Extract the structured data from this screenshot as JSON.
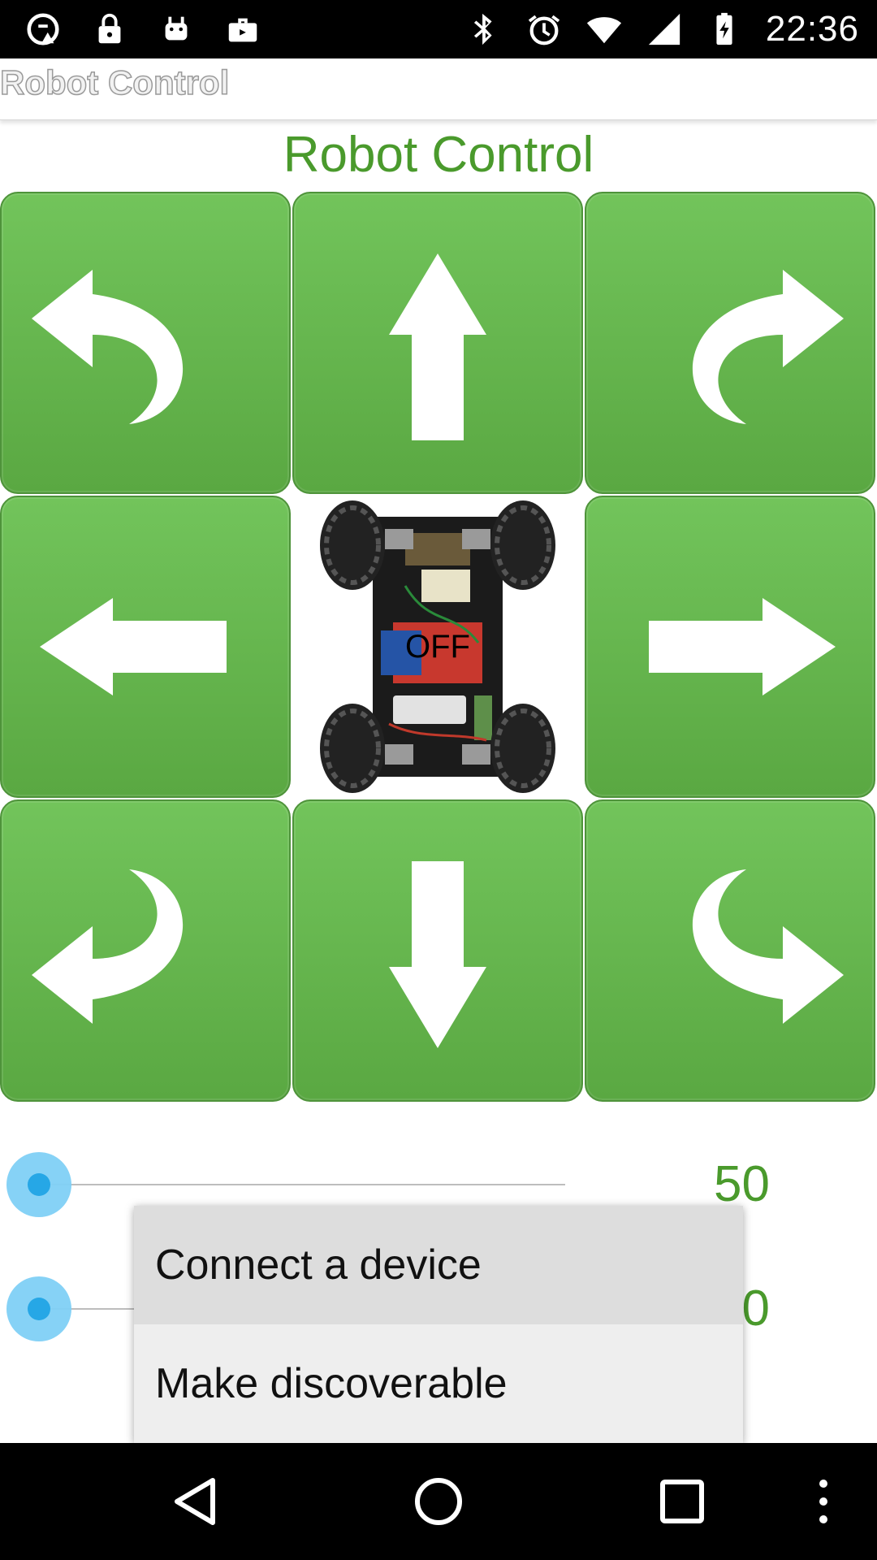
{
  "status_bar": {
    "time": "22:36",
    "left_icons": [
      "cast-warning-icon",
      "lock-icon",
      "android-icon",
      "briefcase-icon"
    ],
    "right_icons": [
      "bluetooth-icon",
      "alarm-icon",
      "wifi-icon",
      "signal-icon",
      "battery-charging-icon"
    ]
  },
  "action_bar": {
    "title": "Robot Control"
  },
  "heading": "Robot Control",
  "controls": {
    "buttons": [
      {
        "name": "turn-left-forward",
        "icon": "curved-arrow-left-icon"
      },
      {
        "name": "forward",
        "icon": "arrow-up-icon"
      },
      {
        "name": "turn-right-forward",
        "icon": "curved-arrow-right-icon"
      },
      {
        "name": "left",
        "icon": "arrow-left-icon"
      },
      {
        "name": "right",
        "icon": "arrow-right-icon"
      },
      {
        "name": "turn-left-backward",
        "icon": "curved-arrow-down-left-icon"
      },
      {
        "name": "backward",
        "icon": "arrow-down-icon"
      },
      {
        "name": "turn-right-backward",
        "icon": "curved-arrow-down-right-icon"
      }
    ],
    "robot_status": "OFF"
  },
  "sliders": [
    {
      "value": "50",
      "level": 0
    },
    {
      "value": "0",
      "level": 0
    }
  ],
  "popup_menu": {
    "items": [
      {
        "label": "Connect a device"
      },
      {
        "label": "Make discoverable"
      }
    ]
  },
  "colors": {
    "accent_green": "#4a9a2c",
    "button_green": "#66b64e",
    "slider_blue": "#26a7e6"
  }
}
